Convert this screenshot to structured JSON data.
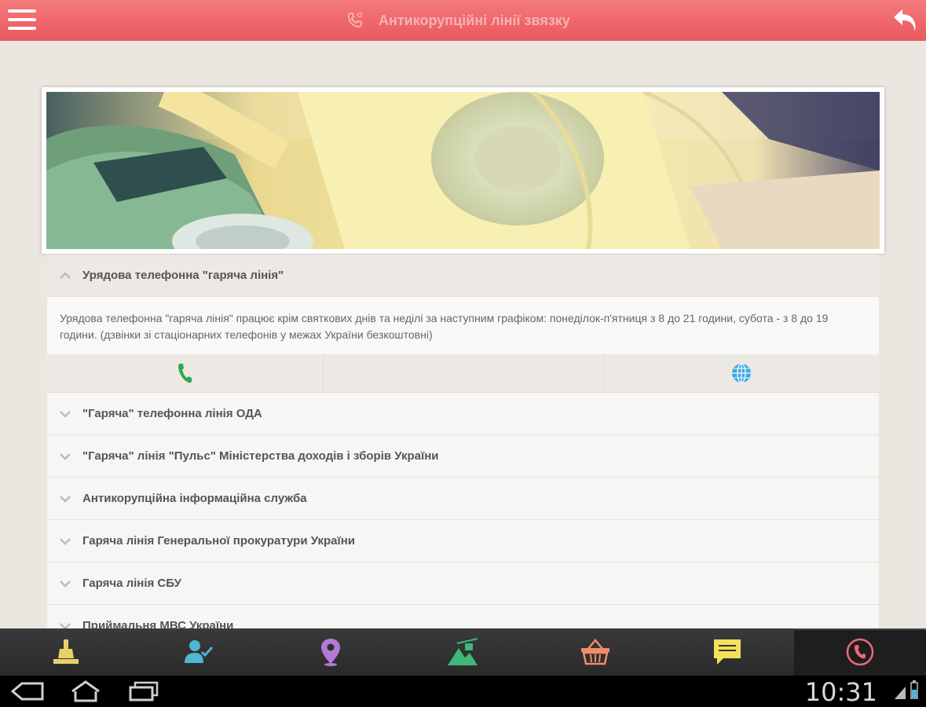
{
  "header": {
    "title": "Антикорупційні лінії звязку",
    "menu_icon": "hamburger-menu-icon",
    "title_icon": "phone-icon",
    "back_icon": "back-arrow-icon",
    "color": "#ee6a6d"
  },
  "accordion": {
    "open_item": {
      "title": "Урядова телефонна \"гаряча лінія\"",
      "body": "Урядова телефонна \"гаряча лінія\" працює крім святкових днів та неділі за наступним графіком: понеділок-п'ятниця з 8 до 21 години, субота - з 8 до 19 години. (дзвінки зі стаціонарних телефонів у межах України безкоштовні)",
      "actions": [
        "phone-call-icon",
        "globe-icon"
      ]
    },
    "items": [
      {
        "title": "\"Гаряча\" телефонна лінія ОДА"
      },
      {
        "title": "\"Гаряча\" лінія \"Пульс\" Міністерства доходів і зборів України"
      },
      {
        "title": "Антикорупційна інформаційна служба"
      },
      {
        "title": "Гаряча лінія Генеральної прокуратури України"
      },
      {
        "title": "Гаряча лінія СБУ"
      },
      {
        "title": "Приймальня МВС України"
      }
    ]
  },
  "bottom_nav": {
    "items": [
      "monument-icon",
      "person-check-icon",
      "map-pin-icon",
      "mountain-cable-car-icon",
      "basket-icon",
      "chat-icon",
      "phone-circle-icon"
    ],
    "active": "phone-circle-icon"
  },
  "system_bar": {
    "time": "10:31",
    "buttons": [
      "back-nav-icon",
      "home-nav-icon",
      "recent-apps-icon"
    ]
  }
}
